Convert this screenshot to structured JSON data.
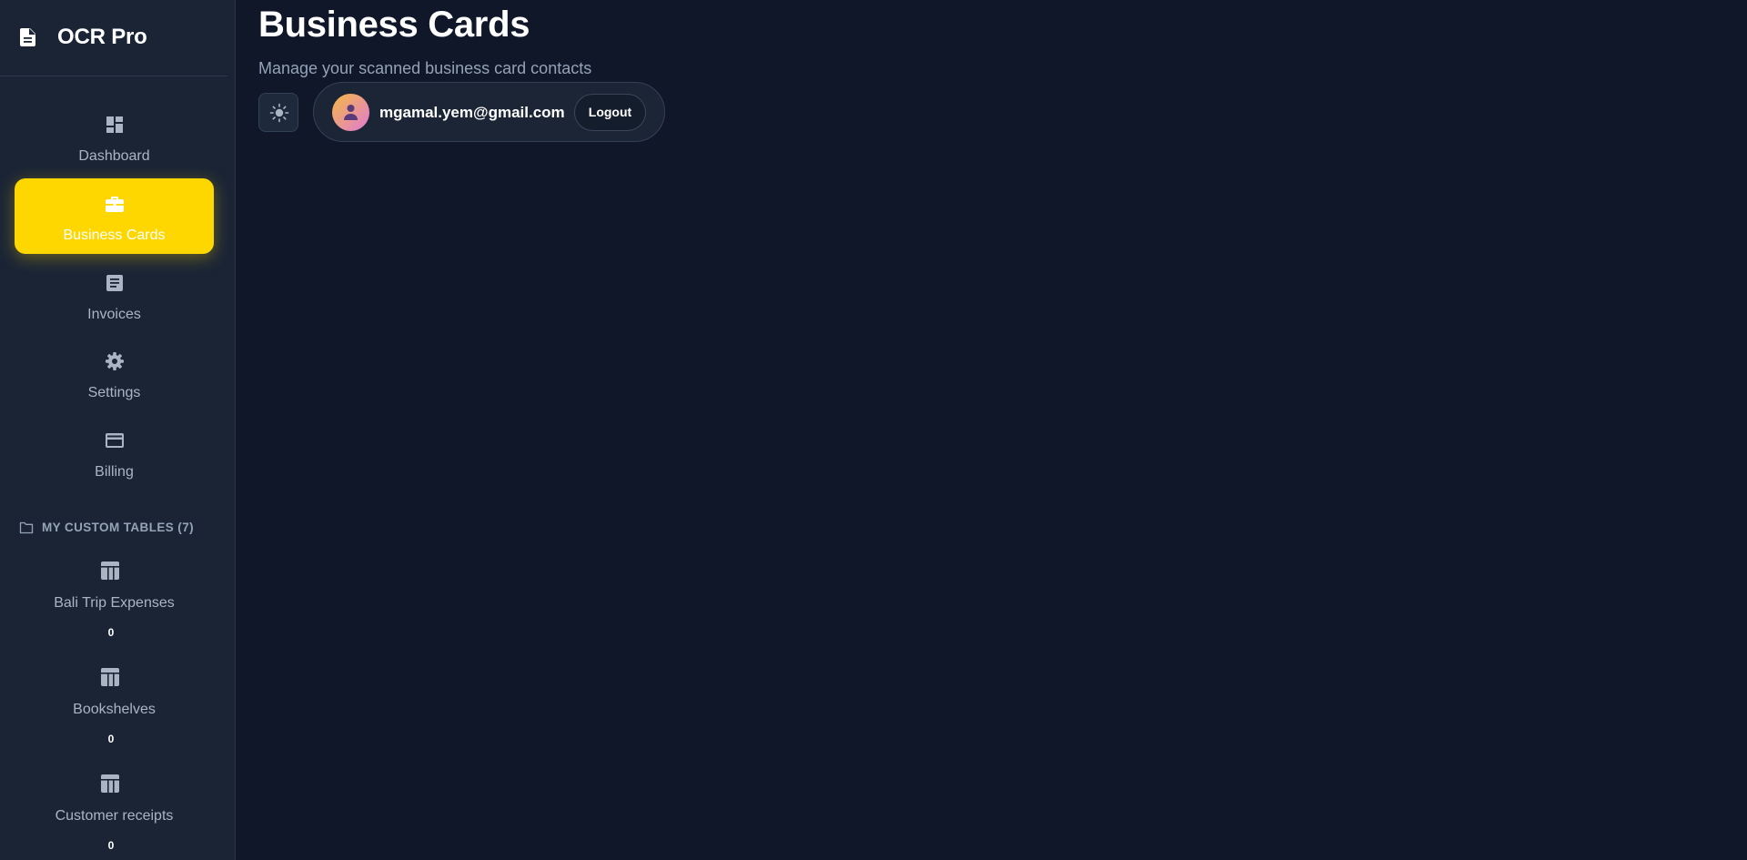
{
  "app": {
    "name": "OCR Pro",
    "logo_icon": "document-icon"
  },
  "nav": [
    {
      "label": "Dashboard",
      "icon": "dashboard-icon",
      "active": false
    },
    {
      "label": "Business Cards",
      "icon": "briefcase-icon",
      "active": true
    },
    {
      "label": "Invoices",
      "icon": "receipt-icon",
      "active": false
    },
    {
      "label": "Settings",
      "icon": "gear-icon",
      "active": false
    },
    {
      "label": "Billing",
      "icon": "credit-card-icon",
      "active": false
    }
  ],
  "custom_tables": {
    "heading": "MY CUSTOM TABLES (7)",
    "items": [
      {
        "label": "Bali Trip Expenses",
        "count": "0"
      },
      {
        "label": "Bookshelves",
        "count": "0"
      },
      {
        "label": "Customer receipts",
        "count": "0"
      }
    ]
  },
  "page": {
    "title": "Business Cards",
    "subtitle": "Manage your scanned business card contacts"
  },
  "user": {
    "email": "mgamal.yem@gmail.com",
    "logout_label": "Logout"
  },
  "colors": {
    "background": "#0f1729",
    "sidebar": "#1a2435",
    "active_nav": "#ffd700",
    "muted_text": "#aab4c3"
  }
}
